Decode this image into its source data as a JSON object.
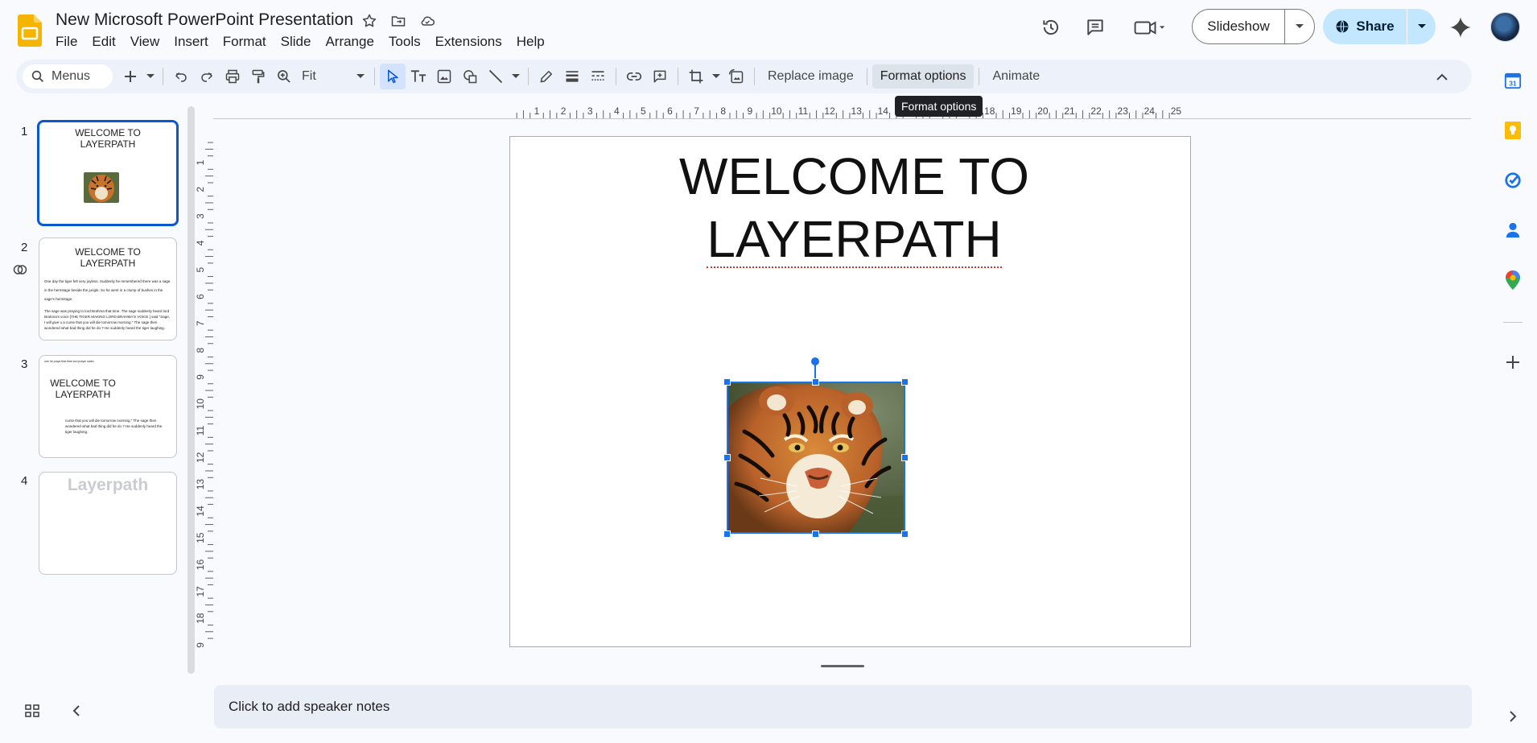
{
  "app": {
    "doc_title": "New Microsoft PowerPoint Presentation",
    "menus": [
      "File",
      "Edit",
      "View",
      "Insert",
      "Format",
      "Slide",
      "Arrange",
      "Tools",
      "Extensions",
      "Help"
    ]
  },
  "header": {
    "slideshow_label": "Slideshow",
    "share_label": "Share"
  },
  "toolbar": {
    "search_placeholder": "Menus",
    "zoom_value": "Fit",
    "replace_image_label": "Replace image",
    "format_options_label": "Format options",
    "animate_label": "Animate",
    "tooltip": "Format options"
  },
  "rulers": {
    "horizontal": [
      "1",
      "2",
      "3",
      "4",
      "5",
      "6",
      "7",
      "8",
      "9",
      "10",
      "11",
      "12",
      "13",
      "14",
      "15",
      "16",
      "17",
      "18",
      "19",
      "20",
      "21",
      "22",
      "23",
      "24",
      "25"
    ],
    "vertical": [
      "1",
      "2",
      "3",
      "4",
      "5",
      "6",
      "7",
      "8",
      "9",
      "10",
      "11",
      "12",
      "13",
      "14",
      "15",
      "16",
      "17",
      "18",
      "9"
    ]
  },
  "filmstrip": {
    "slides": [
      {
        "number": "1",
        "title": "WELCOME TO LAYERPATH",
        "selected": true
      },
      {
        "number": "2",
        "title": "WELCOME TO LAYERPATH",
        "body1": "One day the tiger felt very joyless. Suddenly he remembered there was a sage in the hermitage beside the jungle. So he went in a clump of bushes in the sage's hermitage.",
        "body2": "The sage was praying to lord Brahma that time. The sage suddenly heard lord Brahma's voice [THE TIGER MAKING LORD BRAHMA'S VOICE ] said \"Sage, I will give u a curse that you will die tomorrow morning.\" The sage then wondered what bad thing did he do ? He suddenly heard the tiger laughing."
      },
      {
        "number": "3",
        "title": "WELCOME TO LAYERPATH",
        "top_note": "one he prays that time lord prayer sales",
        "body": "curse that you will die tomorrow morning.\" The sage then wondered what bad thing did he do ? He suddenly heard the tiger laughing."
      },
      {
        "number": "4",
        "title": "Layerpath"
      }
    ]
  },
  "slide": {
    "title_line1": "WELCOME TO",
    "title_line2": "LAYERPATH"
  },
  "notes": {
    "placeholder": "Click to add speaker notes"
  },
  "colors": {
    "accent": "#0b57d0",
    "selection": "#1a73e8",
    "share_bg": "#c2e7ff",
    "toolbar_bg": "#edf2fa",
    "logo_yellow": "#f4b400"
  },
  "icons": {
    "side_panel": [
      "calendar-icon",
      "keep-icon",
      "tasks-icon",
      "contacts-icon",
      "maps-icon",
      "add-icon"
    ]
  }
}
